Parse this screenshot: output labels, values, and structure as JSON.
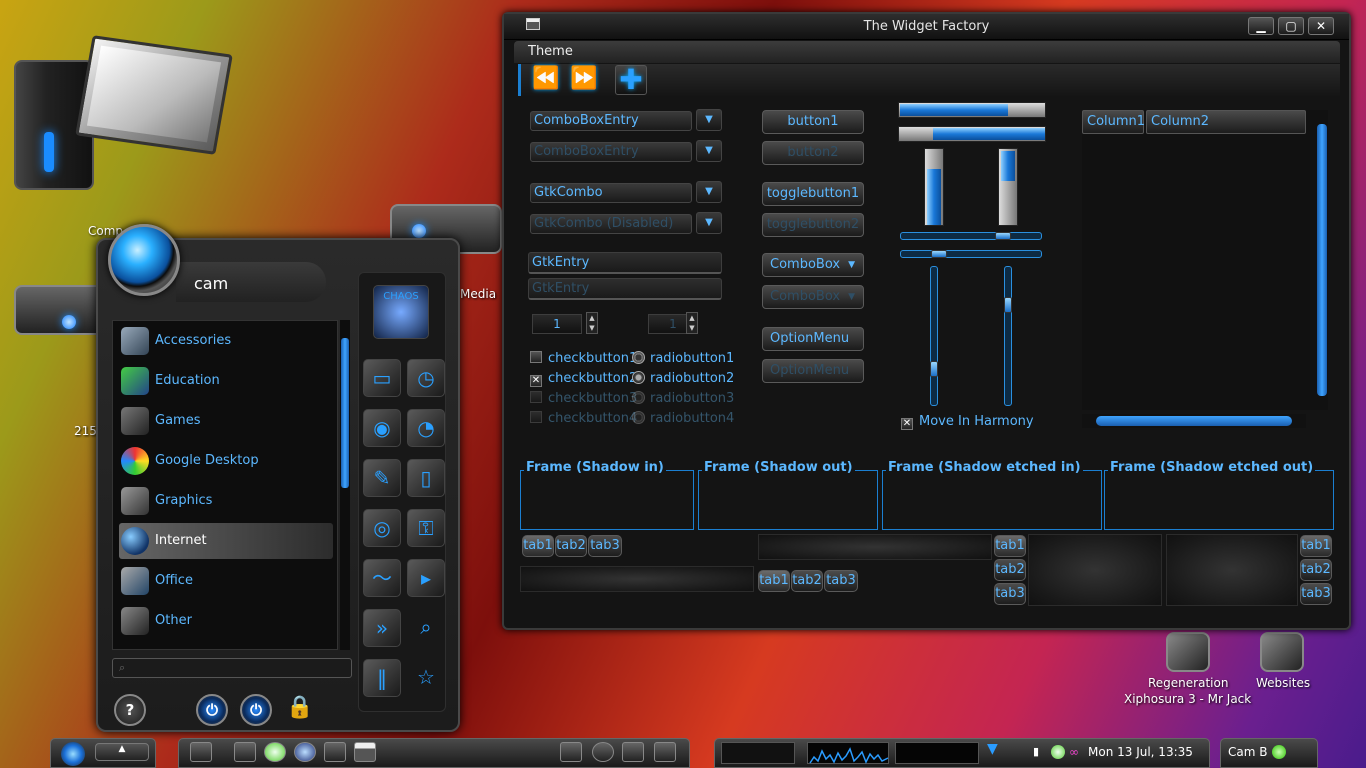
{
  "desktop": {
    "icons": [
      {
        "label": "Comp"
      },
      {
        "label": "Media"
      },
      {
        "label": "215"
      },
      {
        "label": "Regeneration"
      },
      {
        "label": "Websites"
      }
    ],
    "wallpaper_credit": "Xiphosura 3 - Mr Jack"
  },
  "window": {
    "title": "The Widget Factory",
    "buttons": {
      "minimize": "▁",
      "maximize": "▢",
      "close": "✕"
    },
    "menu": [
      "Theme"
    ],
    "toolbar": [
      "back-icon",
      "forward-icon",
      "add-icon"
    ]
  },
  "widgets": {
    "combo1": "ComboBoxEntry",
    "combo1_disabled": "ComboBoxEntry",
    "gtkcombo": "GtkCombo",
    "gtkcombo_disabled": "GtkCombo (Disabled)",
    "entry": "GtkEntry",
    "entry_disabled": "GtkEntry",
    "spin1": "1",
    "spin2": "1",
    "checkbuttons": [
      "checkbutton1",
      "checkbutton2",
      "checkbutton3",
      "checkbutton4"
    ],
    "radiobuttons": [
      "radiobutton1",
      "radiobutton2",
      "radiobutton3",
      "radiobutton4"
    ],
    "button1": "button1",
    "button2": "button2",
    "togglebutton1": "togglebutton1",
    "togglebutton2": "togglebutton2",
    "combobox": "ComboBox",
    "combobox_disabled": "ComboBox",
    "optionmenu": "OptionMenu",
    "optionmenu_disabled": "OptionMenu",
    "progress_h1": 0.75,
    "progress_h2": 0.78,
    "progress_v1": 0.75,
    "progress_v2": 0.4,
    "move_in_harmony": "Move In Harmony",
    "columns": [
      "Column1",
      "Column2"
    ],
    "frames": [
      "Frame (Shadow in)",
      "Frame (Shadow out)",
      "Frame (Shadow etched in)",
      "Frame (Shadow etched out)"
    ],
    "tabs": [
      "tab1",
      "tab2",
      "tab3"
    ]
  },
  "startmenu": {
    "user": "cam",
    "categories": [
      "Accessories",
      "Education",
      "Games",
      "Google Desktop",
      "Graphics",
      "Internet",
      "Office",
      "Other"
    ],
    "highlighted": "Internet",
    "side_logo": "CHAOS"
  },
  "taskbar": {
    "clock": "Mon 13 Jul, 13:35",
    "user": "Cam B"
  }
}
